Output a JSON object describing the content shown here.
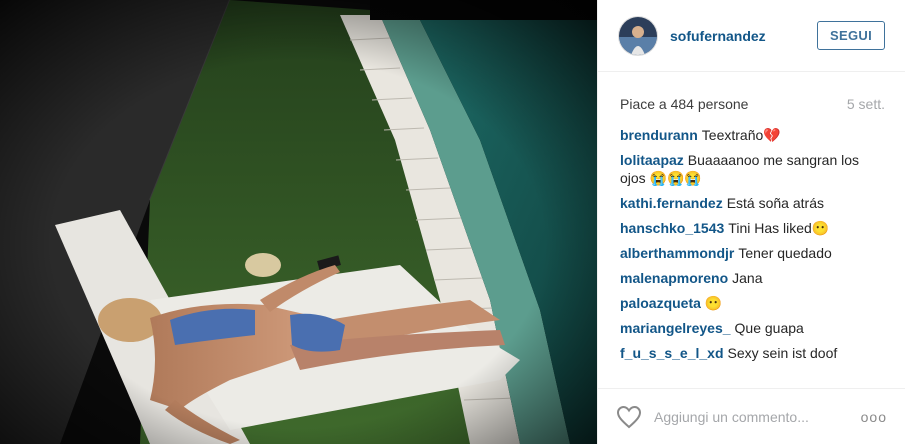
{
  "post": {
    "username": "sofufernandez",
    "follow_label": "SEGUI",
    "likes_text": "Piace a 484 persone",
    "time_ago": "5 sett.",
    "comments": [
      {
        "user": "brendurann",
        "text": "Teextraño💔"
      },
      {
        "user": "lolitaapaz",
        "text": "Buaaaanoo me sangran los ojos 😭😭😭"
      },
      {
        "user": "kathi.fernandez",
        "text": "Está soña atrás"
      },
      {
        "user": "hanschko_1543",
        "text": "Tini Has liked😶"
      },
      {
        "user": "alberthammondjr",
        "text": "Tener quedado"
      },
      {
        "user": "malenapmoreno",
        "text": "Jana"
      },
      {
        "user": "paloazqueta",
        "text": "😶"
      },
      {
        "user": "mariangelreyes_",
        "text": "Que guapa"
      },
      {
        "user": "f_u_s_s_e_l_xd",
        "text": "Sexy sein ist doof"
      }
    ],
    "comment_placeholder": "Aggiungi un commento...",
    "more_label": "ooo"
  },
  "icons": {
    "like": "heart-outline-icon",
    "more": "more-options-icon"
  },
  "colors": {
    "username": "#125688",
    "follow_border": "#3f729b",
    "muted": "#a5a7aa"
  }
}
